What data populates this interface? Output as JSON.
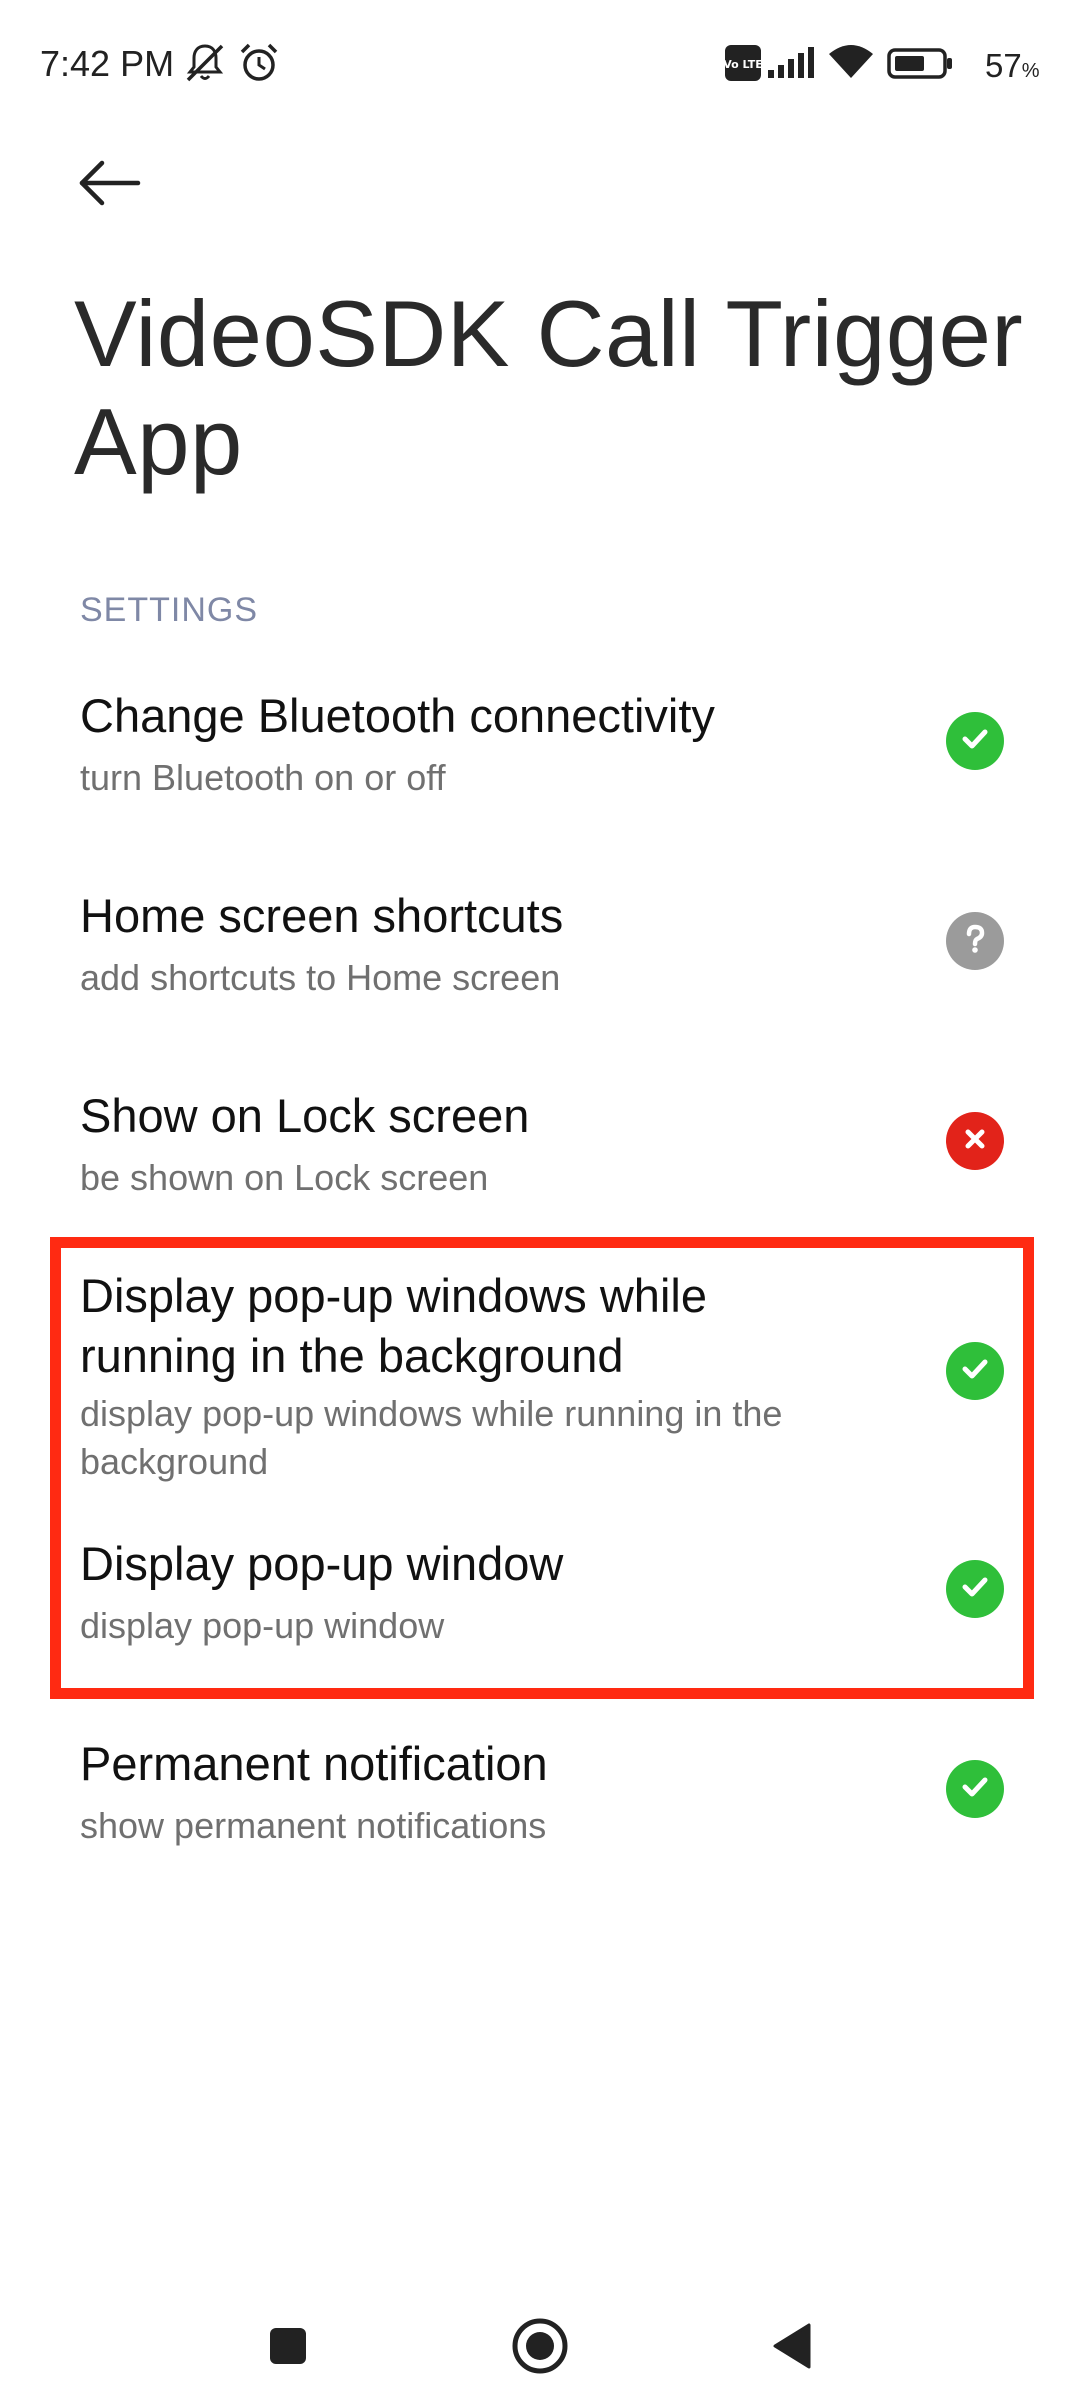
{
  "status_bar": {
    "time": "7:42 PM",
    "battery_percent": "57",
    "battery_percent_sign": "%",
    "battery_level": 0.57,
    "volte_label": "Vo LTE",
    "icons": [
      "mute-icon",
      "alarm-icon",
      "volte-icon",
      "signal-icon",
      "wifi-icon",
      "battery-icon"
    ]
  },
  "header": {
    "back_icon": "arrow-left-icon",
    "title": "VideoSDK Call Trigger App"
  },
  "section": {
    "label": "SETTINGS"
  },
  "settings": [
    {
      "title": "Change Bluetooth connectivity",
      "subtitle": "turn Bluetooth on or off",
      "status": "granted",
      "icon": "check-icon"
    },
    {
      "title": "Home screen shortcuts",
      "subtitle": "add shortcuts to Home screen",
      "status": "unknown",
      "icon": "question-icon"
    },
    {
      "title": "Show on Lock screen",
      "subtitle": "be shown on Lock screen",
      "status": "denied",
      "icon": "cross-icon"
    },
    {
      "title": "Display pop-up windows while running in the background",
      "subtitle": "display pop-up windows while running in the background",
      "status": "granted",
      "icon": "check-icon"
    },
    {
      "title": "Display pop-up window",
      "subtitle": "display pop-up window",
      "status": "granted",
      "icon": "check-icon"
    },
    {
      "title": "Permanent notification",
      "subtitle": "show permanent notifications",
      "status": "granted",
      "icon": "check-icon"
    }
  ],
  "colors": {
    "granted": "#2fbf3a",
    "unknown": "#9b9b9b",
    "denied": "#e2231a",
    "highlight": "#ff2a12",
    "section_label": "#7f88a6"
  },
  "nav_bar": {
    "icons": [
      "recents-square-icon",
      "home-circle-icon",
      "back-triangle-icon"
    ]
  }
}
